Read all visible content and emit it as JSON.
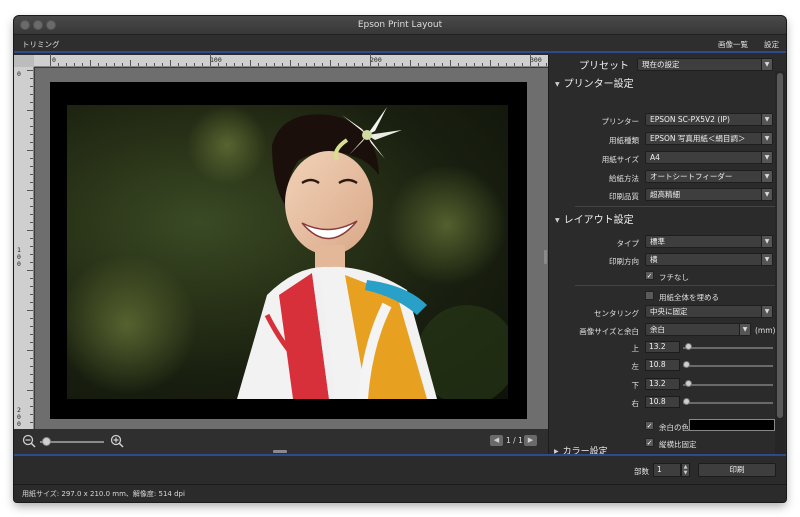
{
  "window": {
    "title": "Epson Print Layout"
  },
  "menu": {
    "left": "トリミング",
    "image_list": "画像一覧",
    "settings": "設定"
  },
  "ruler": {
    "top_labels": [
      "0",
      "100",
      "200",
      "300"
    ],
    "left_labels": [
      "0",
      "100",
      "200"
    ]
  },
  "canvas": {
    "page_indicator": "1 / 1",
    "zoom_out_icon": "zoom-out-icon",
    "zoom_in_icon": "zoom-in-icon"
  },
  "panel": {
    "preset": {
      "label": "プリセット",
      "value": "現在の設定"
    },
    "printer_section": {
      "title": "プリンター設定",
      "printer": {
        "label": "プリンター",
        "value": "EPSON SC-PX5V2 (IP)"
      },
      "paper_type": {
        "label": "用紙種類",
        "value": "EPSON 写真用紙＜絹目調＞"
      },
      "paper_size": {
        "label": "用紙サイズ",
        "value": "A4"
      },
      "feed": {
        "label": "給紙方法",
        "value": "オートシートフィーダー"
      },
      "quality": {
        "label": "印刷品質",
        "value": "超高精細"
      }
    },
    "layout_section": {
      "title": "レイアウト設定",
      "type": {
        "label": "タイプ",
        "value": "標準"
      },
      "orientation": {
        "label": "印刷方向",
        "value": "横"
      },
      "borderless": {
        "label": "フチなし",
        "checked": true
      },
      "fill_paper": {
        "label": "用紙全体を埋める",
        "checked": false
      },
      "centering": {
        "label": "センタリング",
        "value": "中央に固定"
      },
      "size_margin": {
        "label": "画像サイズと余白",
        "value": "余白",
        "unit": "(mm)"
      },
      "margins": [
        {
          "label": "上",
          "value": "13.2"
        },
        {
          "label": "左",
          "value": "10.8"
        },
        {
          "label": "下",
          "value": "13.2"
        },
        {
          "label": "右",
          "value": "10.8"
        }
      ],
      "margin_color": {
        "label": "余白の色",
        "checked": true,
        "color": "#000000"
      },
      "lock_ratio": {
        "label": "縦横比固定",
        "checked": true
      }
    },
    "color_section": {
      "title": "カラー設定"
    }
  },
  "actions": {
    "copies_label": "部数",
    "copies_value": "1",
    "print_label": "印刷"
  },
  "status": {
    "text": "用紙サイズ: 297.0 x 210.0 mm、解像度: 514 dpi"
  },
  "colors": {
    "accent": "#2c4a8c",
    "panel_bg": "#2b2b2b"
  }
}
